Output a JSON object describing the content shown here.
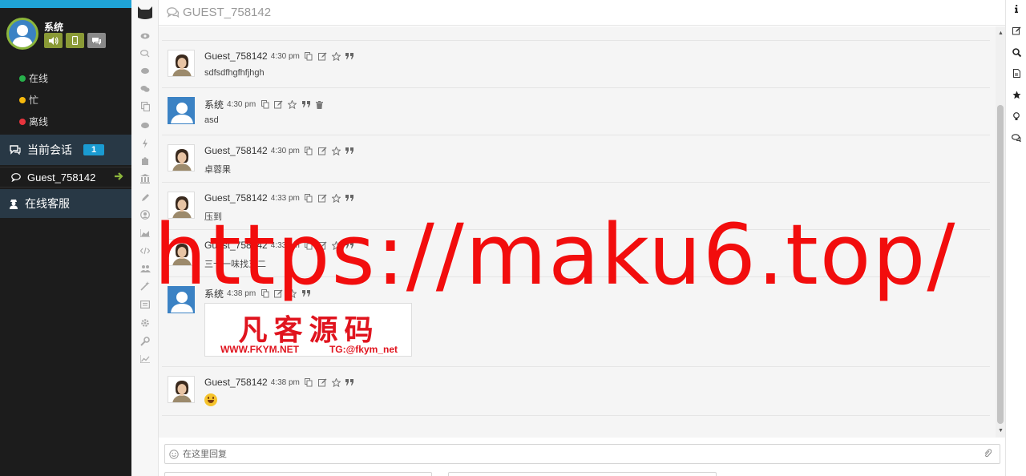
{
  "profile": {
    "name": "系统",
    "buttons": [
      "volume-icon",
      "mobile-icon",
      "chat-icon"
    ]
  },
  "statuses": [
    {
      "label": "在线",
      "color": "#27b04b"
    },
    {
      "label": "忙",
      "color": "#f5b80c"
    },
    {
      "label": "离线",
      "color": "#e8343d"
    }
  ],
  "nav": {
    "sessions_label": "当前会话",
    "sessions_count": "1",
    "guest_label": "Guest_758142",
    "online_service_label": "在线客服"
  },
  "header": {
    "title": "GUEST_758142"
  },
  "messages": [
    {
      "who": "Guest_758142",
      "time": "4:30 pm",
      "body": "sdfsdfhgfhfjhgh",
      "sender": "guest"
    },
    {
      "who": "系统",
      "time": "4:30 pm",
      "body": "asd",
      "sender": "system"
    },
    {
      "who": "Guest_758142",
      "time": "4:30 pm",
      "body": "卓蓉果",
      "sender": "guest"
    },
    {
      "who": "Guest_758142",
      "time": "4:33 pm",
      "body": "压到",
      "sender": "guest"
    },
    {
      "who": "Guest_758142",
      "time": "4:33 pm",
      "body": "三十一味找五二",
      "sender": "guest"
    },
    {
      "who": "系统",
      "time": "4:38 pm",
      "body": "",
      "sender": "system",
      "card": {
        "title": "凡客源码",
        "site": "WWW.FKYM.NET",
        "tg": "TG:@fkym_net"
      }
    },
    {
      "who": "Guest_758142",
      "time": "4:38 pm",
      "body": "",
      "sender": "guest",
      "emoji": "grinning-emoji"
    }
  ],
  "reply": {
    "placeholder": "在这里回复"
  },
  "watermark": "https://maku6.top/",
  "colors": {
    "accent": "#1a9bd2",
    "sidebar_bg": "#1c1c1c",
    "nav_bg": "#283845",
    "profile_btn": "#8a9a36"
  }
}
